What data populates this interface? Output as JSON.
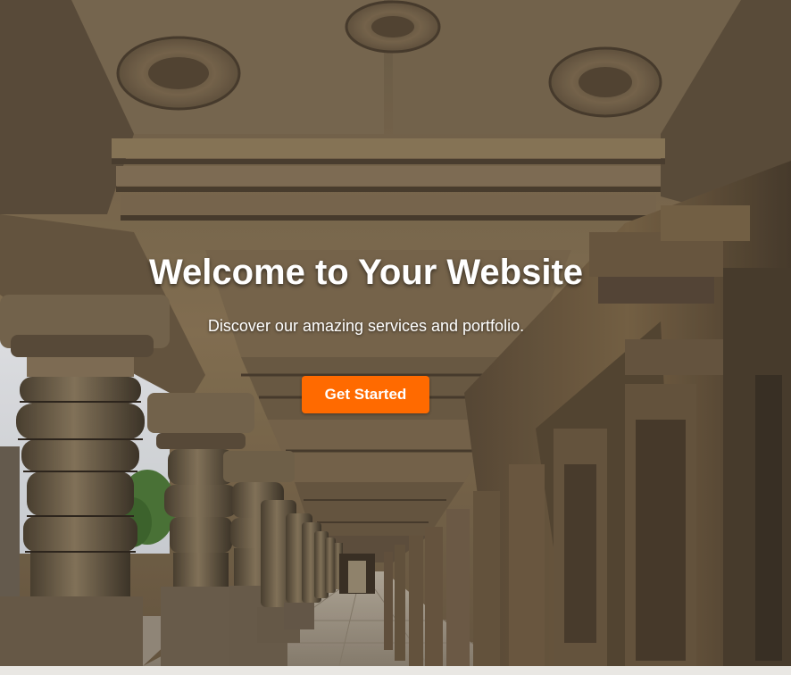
{
  "hero": {
    "title": "Welcome to Your Website",
    "subtitle": "Discover our amazing services and portfolio.",
    "cta_label": "Get Started",
    "background_image": "temple-colonnade-photo"
  },
  "colors": {
    "cta_background": "#ff6a00",
    "text": "#ffffff",
    "page_background": "#e9e7e3"
  }
}
